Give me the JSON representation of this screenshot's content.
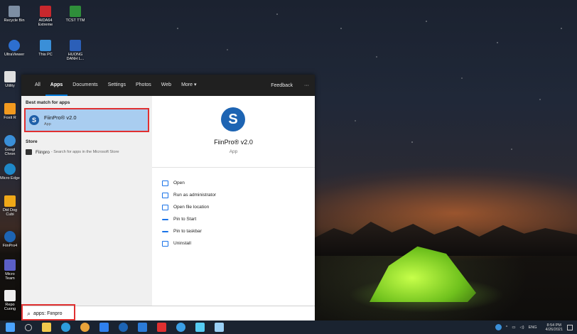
{
  "desktop": {
    "icons": [
      {
        "label": "Recycle Bin"
      },
      {
        "label": "AIDA64 Extreme"
      },
      {
        "label": "TCST TTM"
      },
      {
        "label": "UltraViewer"
      },
      {
        "label": "This PC"
      },
      {
        "label": "HUONG DANH L..."
      },
      {
        "label": "Utility"
      },
      {
        "label": "Foxit R"
      },
      {
        "label": "Googl Chron"
      },
      {
        "label": "Micro Edge"
      },
      {
        "label": "Dtd Dog Cubi"
      },
      {
        "label": "FiinPro4"
      },
      {
        "label": "Micro Team"
      },
      {
        "label": "Repo Cuong"
      }
    ]
  },
  "search_panel": {
    "tabs": [
      "All",
      "Apps",
      "Documents",
      "Settings",
      "Photos",
      "Web",
      "More ▾"
    ],
    "active_tab": "Apps",
    "feedback_label": "Feedback",
    "more_options": "···",
    "best_match_heading": "Best match for apps",
    "best_match": {
      "name": "FiinPro® v2.0",
      "type": "App"
    },
    "store_heading": "Store",
    "store_item": {
      "name": "Fiinpro",
      "subtitle": "- Search for apps in the Microsoft Store"
    },
    "detail": {
      "name": "FiinPro® v2.0",
      "type": "App"
    },
    "actions": [
      "Open",
      "Run as administrator",
      "Open file location",
      "Pin to Start",
      "Pin to taskbar",
      "Uninstall"
    ]
  },
  "search_box": {
    "value": "apps: Fiinpro",
    "icon": "search-icon"
  },
  "taskbar": {
    "tray_lang": "ENG",
    "time": "8:54 PM",
    "date": "4/26/2021"
  },
  "colors": {
    "accent": "#0078d7",
    "highlight_red": "#e03030",
    "selection": "#a9cdf0",
    "app_logo_blue": "#1d64b3"
  }
}
